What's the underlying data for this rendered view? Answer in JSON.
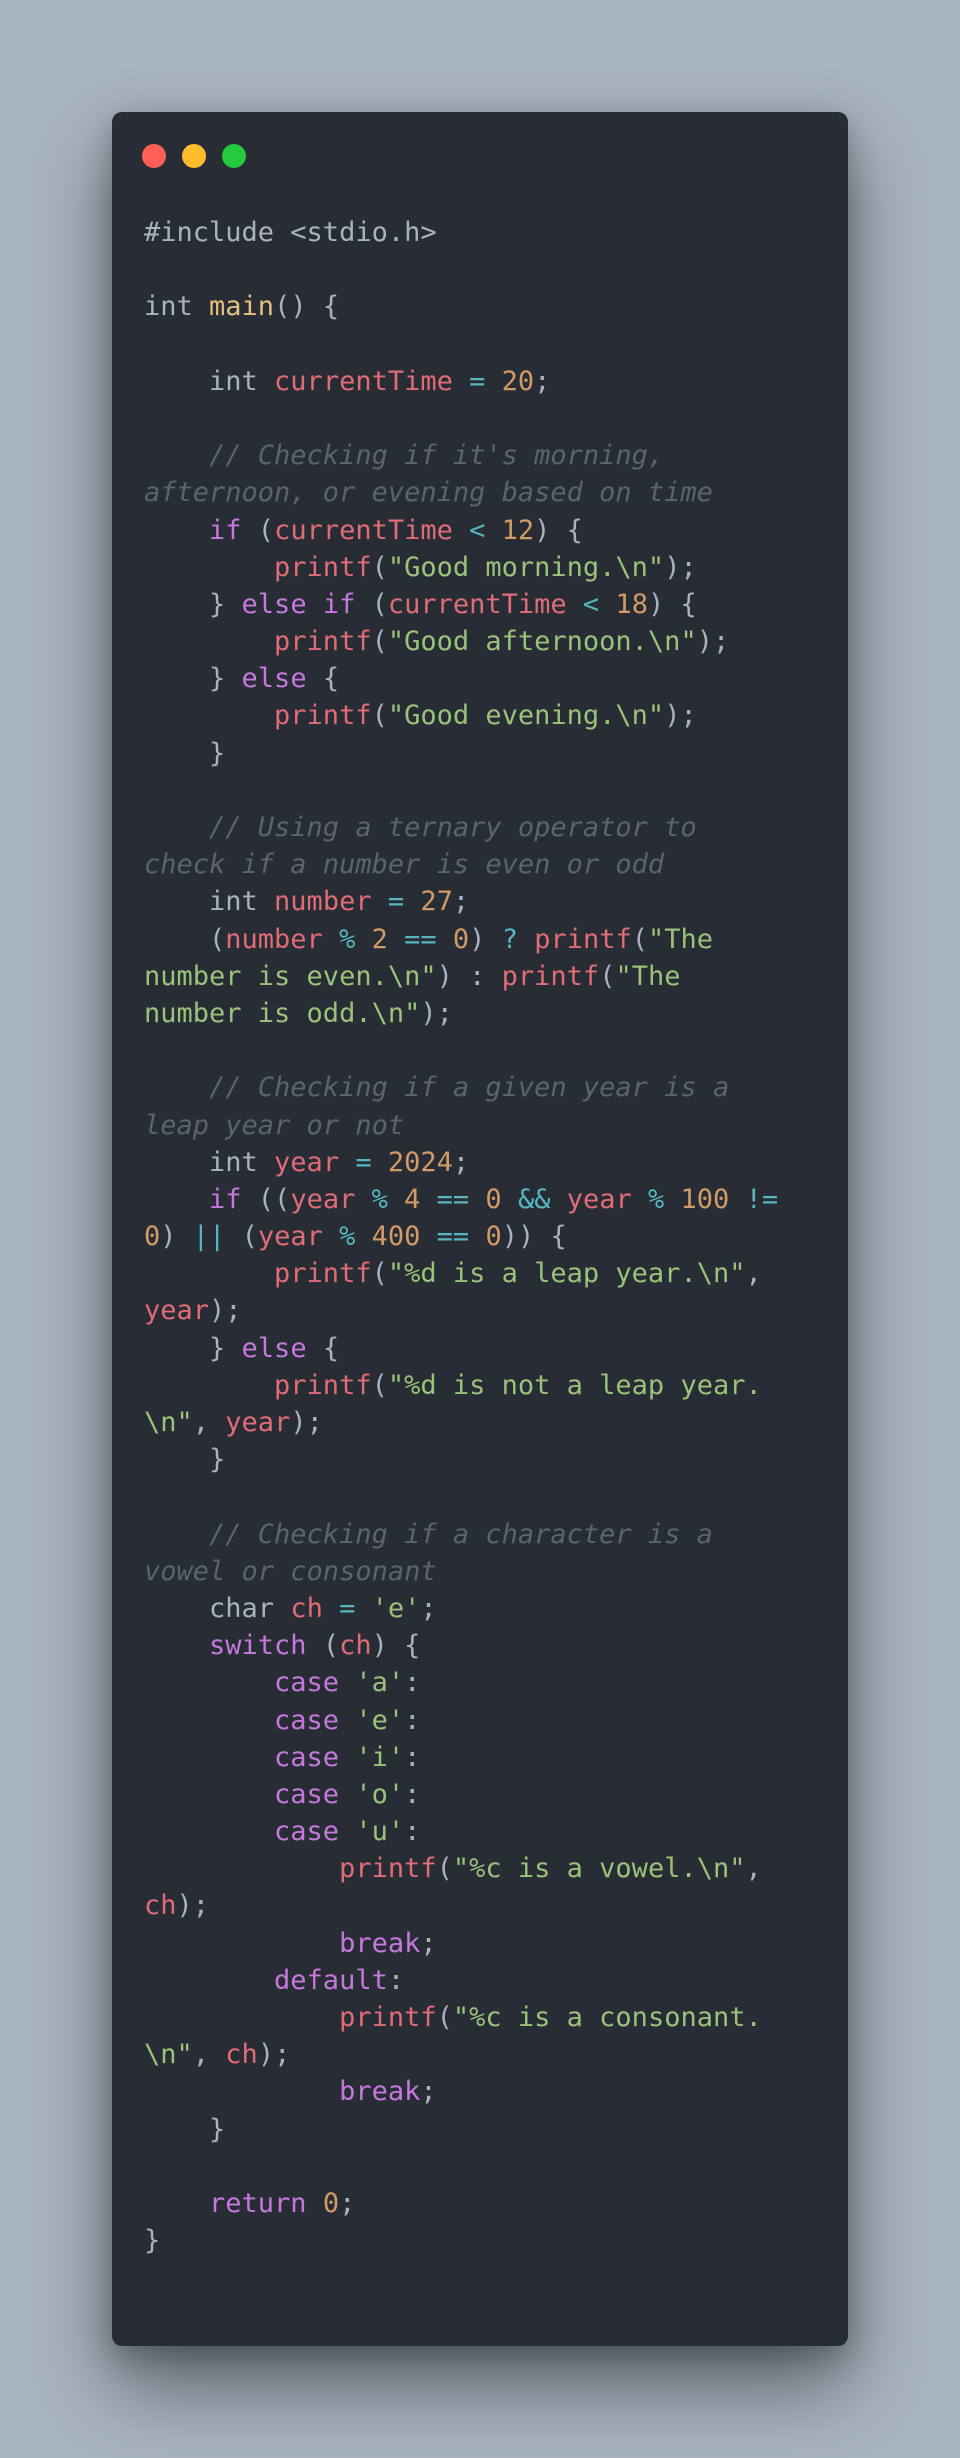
{
  "window": {
    "buttons": [
      {
        "name": "close",
        "color": "#ff5f56"
      },
      {
        "name": "minimize",
        "color": "#ffbd2e"
      },
      {
        "name": "maximize",
        "color": "#27c93f"
      }
    ]
  },
  "colors": {
    "background": "#a8b4c0",
    "editor_bg": "#282c34",
    "keyword": "#c678dd",
    "variable": "#e06c75",
    "number": "#d19a66",
    "string": "#98c379",
    "operator": "#56b6c2",
    "comment": "#5c6370",
    "function_name": "#e5c07b",
    "plain": "#abb2bf"
  },
  "code_lines": [
    [
      [
        "pre",
        "#include <stdio.h>"
      ]
    ],
    [],
    [
      [
        "type",
        "int "
      ],
      [
        "main",
        "main"
      ],
      [
        "pun",
        "() {"
      ]
    ],
    [],
    [
      [
        "type",
        "    int "
      ],
      [
        "var",
        "currentTime"
      ],
      [
        "op",
        " = "
      ],
      [
        "num",
        "20"
      ],
      [
        "pun",
        ";"
      ]
    ],
    [],
    [
      [
        "com",
        "    // Checking if it's morning,"
      ]
    ],
    [
      [
        "com",
        "afternoon, or evening based on time"
      ]
    ],
    [
      [
        "kw",
        "    if "
      ],
      [
        "pun",
        "("
      ],
      [
        "var",
        "currentTime"
      ],
      [
        "op",
        " < "
      ],
      [
        "num",
        "12"
      ],
      [
        "pun",
        ") {"
      ]
    ],
    [
      [
        "fn",
        "        printf"
      ],
      [
        "pun",
        "("
      ],
      [
        "str",
        "\"Good morning.\\n\""
      ],
      [
        "pun",
        ");"
      ]
    ],
    [
      [
        "pun",
        "    } "
      ],
      [
        "kw",
        "else if "
      ],
      [
        "pun",
        "("
      ],
      [
        "var",
        "currentTime"
      ],
      [
        "op",
        " < "
      ],
      [
        "num",
        "18"
      ],
      [
        "pun",
        ") {"
      ]
    ],
    [
      [
        "fn",
        "        printf"
      ],
      [
        "pun",
        "("
      ],
      [
        "str",
        "\"Good afternoon.\\n\""
      ],
      [
        "pun",
        ");"
      ]
    ],
    [
      [
        "pun",
        "    } "
      ],
      [
        "kw",
        "else "
      ],
      [
        "pun",
        "{"
      ]
    ],
    [
      [
        "fn",
        "        printf"
      ],
      [
        "pun",
        "("
      ],
      [
        "str",
        "\"Good evening.\\n\""
      ],
      [
        "pun",
        ");"
      ]
    ],
    [
      [
        "pun",
        "    }"
      ]
    ],
    [],
    [
      [
        "com",
        "    // Using a ternary operator to"
      ]
    ],
    [
      [
        "com",
        "check if a number is even or odd"
      ]
    ],
    [
      [
        "type",
        "    int "
      ],
      [
        "var",
        "number"
      ],
      [
        "op",
        " = "
      ],
      [
        "num",
        "27"
      ],
      [
        "pun",
        ";"
      ]
    ],
    [
      [
        "pun",
        "    ("
      ],
      [
        "var",
        "number"
      ],
      [
        "op",
        " % "
      ],
      [
        "num",
        "2"
      ],
      [
        "op",
        " == "
      ],
      [
        "num",
        "0"
      ],
      [
        "pun",
        ") "
      ],
      [
        "op",
        "? "
      ],
      [
        "fn",
        "printf"
      ],
      [
        "pun",
        "("
      ],
      [
        "str",
        "\"The"
      ]
    ],
    [
      [
        "str",
        "number is even.\\n\""
      ],
      [
        "pun",
        ") : "
      ],
      [
        "fn",
        "printf"
      ],
      [
        "pun",
        "("
      ],
      [
        "str",
        "\"The"
      ]
    ],
    [
      [
        "str",
        "number is odd.\\n\""
      ],
      [
        "pun",
        ");"
      ]
    ],
    [],
    [
      [
        "com",
        "    // Checking if a given year is a"
      ]
    ],
    [
      [
        "com",
        "leap year or not"
      ]
    ],
    [
      [
        "type",
        "    int "
      ],
      [
        "var",
        "year"
      ],
      [
        "op",
        " = "
      ],
      [
        "num",
        "2024"
      ],
      [
        "pun",
        ";"
      ]
    ],
    [
      [
        "kw",
        "    if "
      ],
      [
        "pun",
        "(("
      ],
      [
        "var",
        "year"
      ],
      [
        "op",
        " % "
      ],
      [
        "num",
        "4"
      ],
      [
        "op",
        " == "
      ],
      [
        "num",
        "0"
      ],
      [
        "op",
        " && "
      ],
      [
        "var",
        "year"
      ],
      [
        "op",
        " % "
      ],
      [
        "num",
        "100"
      ],
      [
        "op",
        " !="
      ]
    ],
    [
      [
        "num",
        "0"
      ],
      [
        "pun",
        ") "
      ],
      [
        "op",
        "|| "
      ],
      [
        "pun",
        "("
      ],
      [
        "var",
        "year"
      ],
      [
        "op",
        " % "
      ],
      [
        "num",
        "400"
      ],
      [
        "op",
        " == "
      ],
      [
        "num",
        "0"
      ],
      [
        "pun",
        ")) {"
      ]
    ],
    [
      [
        "fn",
        "        printf"
      ],
      [
        "pun",
        "("
      ],
      [
        "str",
        "\"%d is a leap year.\\n\""
      ],
      [
        "pun",
        ","
      ]
    ],
    [
      [
        "var",
        "year"
      ],
      [
        "pun",
        ");"
      ]
    ],
    [
      [
        "pun",
        "    } "
      ],
      [
        "kw",
        "else "
      ],
      [
        "pun",
        "{"
      ]
    ],
    [
      [
        "fn",
        "        printf"
      ],
      [
        "pun",
        "("
      ],
      [
        "str",
        "\"%d is not a leap year."
      ]
    ],
    [
      [
        "str",
        "\\n\""
      ],
      [
        "pun",
        ", "
      ],
      [
        "var",
        "year"
      ],
      [
        "pun",
        ");"
      ]
    ],
    [
      [
        "pun",
        "    }"
      ]
    ],
    [],
    [
      [
        "com",
        "    // Checking if a character is a"
      ]
    ],
    [
      [
        "com",
        "vowel or consonant"
      ]
    ],
    [
      [
        "type",
        "    char "
      ],
      [
        "var",
        "ch"
      ],
      [
        "op",
        " = "
      ],
      [
        "str",
        "'e'"
      ],
      [
        "pun",
        ";"
      ]
    ],
    [
      [
        "kw",
        "    switch "
      ],
      [
        "pun",
        "("
      ],
      [
        "var",
        "ch"
      ],
      [
        "pun",
        ") {"
      ]
    ],
    [
      [
        "kw",
        "        case "
      ],
      [
        "str",
        "'a'"
      ],
      [
        "pun",
        ":"
      ]
    ],
    [
      [
        "kw",
        "        case "
      ],
      [
        "str",
        "'e'"
      ],
      [
        "pun",
        ":"
      ]
    ],
    [
      [
        "kw",
        "        case "
      ],
      [
        "str",
        "'i'"
      ],
      [
        "pun",
        ":"
      ]
    ],
    [
      [
        "kw",
        "        case "
      ],
      [
        "str",
        "'o'"
      ],
      [
        "pun",
        ":"
      ]
    ],
    [
      [
        "kw",
        "        case "
      ],
      [
        "str",
        "'u'"
      ],
      [
        "pun",
        ":"
      ]
    ],
    [
      [
        "fn",
        "            printf"
      ],
      [
        "pun",
        "("
      ],
      [
        "str",
        "\"%c is a vowel.\\n\""
      ],
      [
        "pun",
        ","
      ]
    ],
    [
      [
        "var",
        "ch"
      ],
      [
        "pun",
        ");"
      ]
    ],
    [
      [
        "kw",
        "            break"
      ],
      [
        "pun",
        ";"
      ]
    ],
    [
      [
        "kw",
        "        default"
      ],
      [
        "pun",
        ":"
      ]
    ],
    [
      [
        "fn",
        "            printf"
      ],
      [
        "pun",
        "("
      ],
      [
        "str",
        "\"%c is a consonant."
      ]
    ],
    [
      [
        "str",
        "\\n\""
      ],
      [
        "pun",
        ", "
      ],
      [
        "var",
        "ch"
      ],
      [
        "pun",
        ");"
      ]
    ],
    [
      [
        "kw",
        "            break"
      ],
      [
        "pun",
        ";"
      ]
    ],
    [
      [
        "pun",
        "    }"
      ]
    ],
    [],
    [
      [
        "kw",
        "    return "
      ],
      [
        "num",
        "0"
      ],
      [
        "pun",
        ";"
      ]
    ],
    [
      [
        "pun",
        "}"
      ]
    ]
  ]
}
